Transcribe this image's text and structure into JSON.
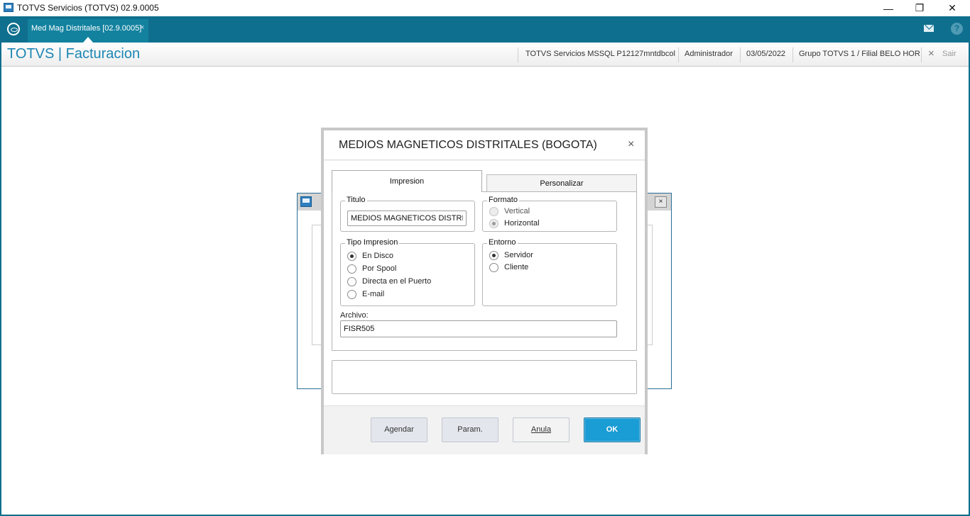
{
  "window": {
    "title": "TOTVS Servicios (TOTVS) 02.9.0005"
  },
  "tabbar": {
    "tab_label": "Med Mag Distritales [02.9.0005]",
    "tab_close": "×"
  },
  "header": {
    "app_title": "TOTVS | Facturacion",
    "environment": "TOTVS Servicios MSSQL P12127mntdbcol",
    "user": "Administrador",
    "date": "03/05/2022",
    "branch": "Grupo TOTVS 1 / Filial BELO HOR",
    "exit_label": "Sair"
  },
  "dialog": {
    "title": "MEDIOS MAGNETICOS DISTRITALES (BOGOTA)",
    "tabs": [
      {
        "label": "Impresion",
        "active": true
      },
      {
        "label": "Personalizar",
        "active": false
      }
    ],
    "titulo": {
      "label": "Titulo",
      "value": "MEDIOS MAGNETICOS DISTRITALES (BOGOTA)"
    },
    "formato": {
      "label": "Formato",
      "options": [
        {
          "label": "Vertical",
          "selected": false
        },
        {
          "label": "Horizontal",
          "selected": true
        }
      ]
    },
    "tipo_impresion": {
      "label": "Tipo Impresion",
      "options": [
        {
          "label": "En Disco",
          "selected": true
        },
        {
          "label": "Por Spool",
          "selected": false
        },
        {
          "label": "Directa en el Puerto",
          "selected": false
        },
        {
          "label": "E-mail",
          "selected": false
        }
      ]
    },
    "entorno": {
      "label": "Entorno",
      "options": [
        {
          "label": "Servidor",
          "selected": true
        },
        {
          "label": "Cliente",
          "selected": false
        }
      ]
    },
    "archivo": {
      "label": "Archivo:",
      "value": "FISR505"
    },
    "buttons": {
      "agendar": "Agendar",
      "param": "Param.",
      "anula": "Anula",
      "ok": "OK"
    }
  },
  "icons": {
    "close": "×",
    "help": "?",
    "win_minimize": "—",
    "win_restore": "❐",
    "win_close": "✕"
  },
  "colors": {
    "tabbar": "#0f6f8e",
    "accent": "#1d86b3",
    "ok_button": "#1a9cd4"
  }
}
